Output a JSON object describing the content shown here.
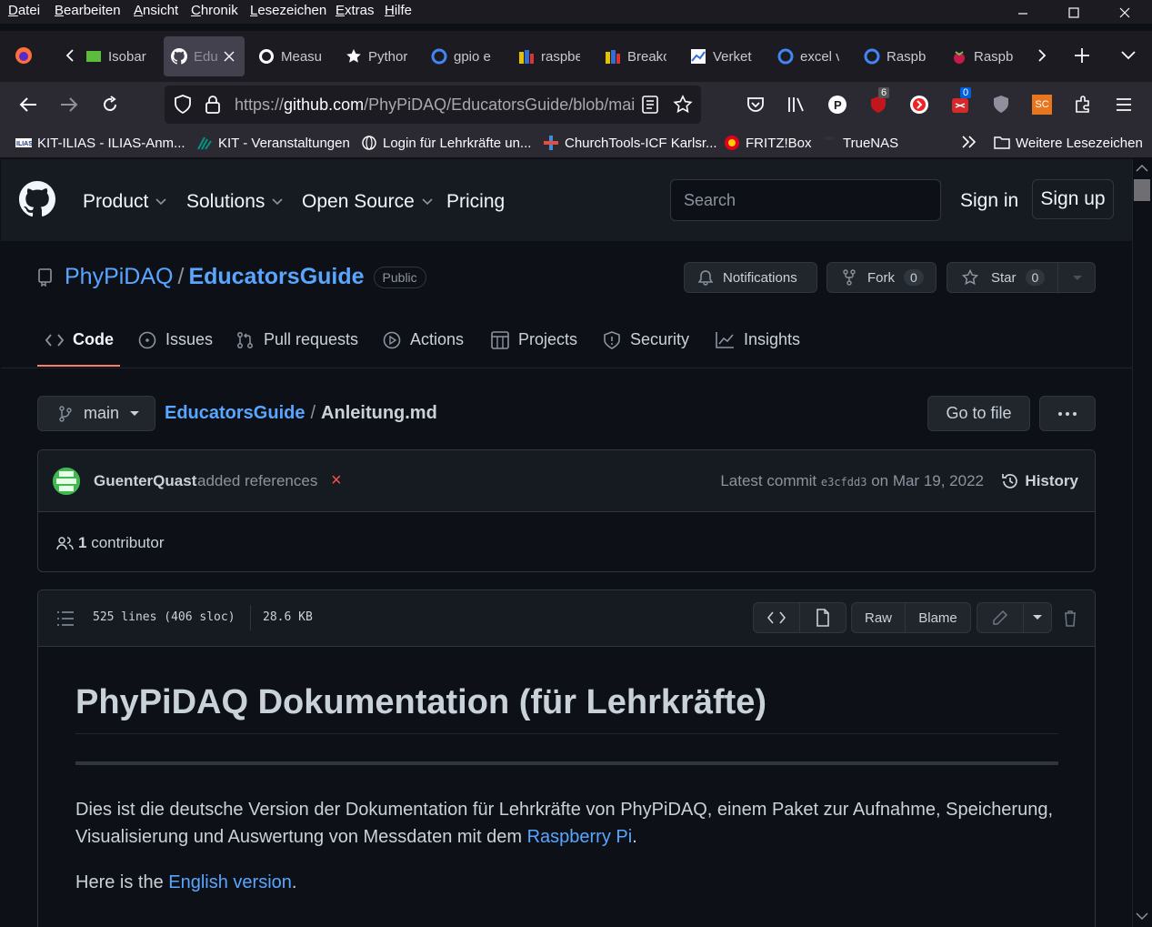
{
  "browser": {
    "menu": [
      "Datei",
      "Bearbeiten",
      "Ansicht",
      "Chronik",
      "Lesezeichen",
      "Extras",
      "Hilfe"
    ],
    "tabs": [
      {
        "title": "Isobar"
      },
      {
        "title": "Edu"
      },
      {
        "title": "Measu"
      },
      {
        "title": "Pythor"
      },
      {
        "title": "gpio e"
      },
      {
        "title": "raspbe"
      },
      {
        "title": "Breako"
      },
      {
        "title": "Verket"
      },
      {
        "title": "excel v"
      },
      {
        "title": "Raspb"
      },
      {
        "title": "Raspb"
      }
    ],
    "url_prefix": "https://",
    "url_host": "github.com",
    "url_path": "/PhyPiDAQ/EducatorsGuide/blob/main",
    "badges": {
      "ublock": "6",
      "ext": "0",
      "sc": "SC"
    },
    "bookmarks": [
      {
        "label": "KIT-ILIAS - ILIAS-Anm..."
      },
      {
        "label": "KIT - Veranstaltungen"
      },
      {
        "label": "Login für Lehrkräfte un..."
      },
      {
        "label": "ChurchTools-ICF Karlsr..."
      },
      {
        "label": "FRITZ!Box"
      },
      {
        "label": "TrueNAS"
      },
      {
        "label": "Weitere Lesezeichen"
      }
    ]
  },
  "header": {
    "nav": [
      "Product",
      "Solutions",
      "Open Source",
      "Pricing"
    ],
    "search_placeholder": "Search",
    "sign_in": "Sign in",
    "sign_up": "Sign up"
  },
  "repo": {
    "owner": "PhyPiDAQ",
    "name": "EducatorsGuide",
    "visibility": "Public",
    "notifications": "Notifications",
    "fork_label": "Fork",
    "fork_count": "0",
    "star_label": "Star",
    "star_count": "0",
    "tabs": [
      "Code",
      "Issues",
      "Pull requests",
      "Actions",
      "Projects",
      "Security",
      "Insights"
    ]
  },
  "file": {
    "branch": "main",
    "repo_link": "EducatorsGuide",
    "filename": "Anleitung.md",
    "go_to_file": "Go to file",
    "commit_author": "GuenterQuast",
    "commit_message": "added references",
    "commit_prefix": "Latest commit",
    "commit_sha": "e3cfdd3",
    "commit_date": "on Mar 19, 2022",
    "history": "History",
    "contributors_count": "1",
    "contributors_label": "contributor",
    "lines": "525 lines (406 sloc)",
    "size": "28.6 KB",
    "raw": "Raw",
    "blame": "Blame"
  },
  "readme": {
    "title": "PhyPiDAQ Dokumentation (für Lehrkräfte)",
    "p1_text": "Dies ist die deutsche Version der Dokumentation für Lehrkräfte von PhyPiDAQ, einem Paket zur Aufnahme, Speicherung, Visualisierung und Auswertung von Messdaten mit dem ",
    "p1_link": "Raspberry Pi",
    "p1_end": ".",
    "p2_text": "Here is the ",
    "p2_link": "English version",
    "p2_end": "."
  }
}
